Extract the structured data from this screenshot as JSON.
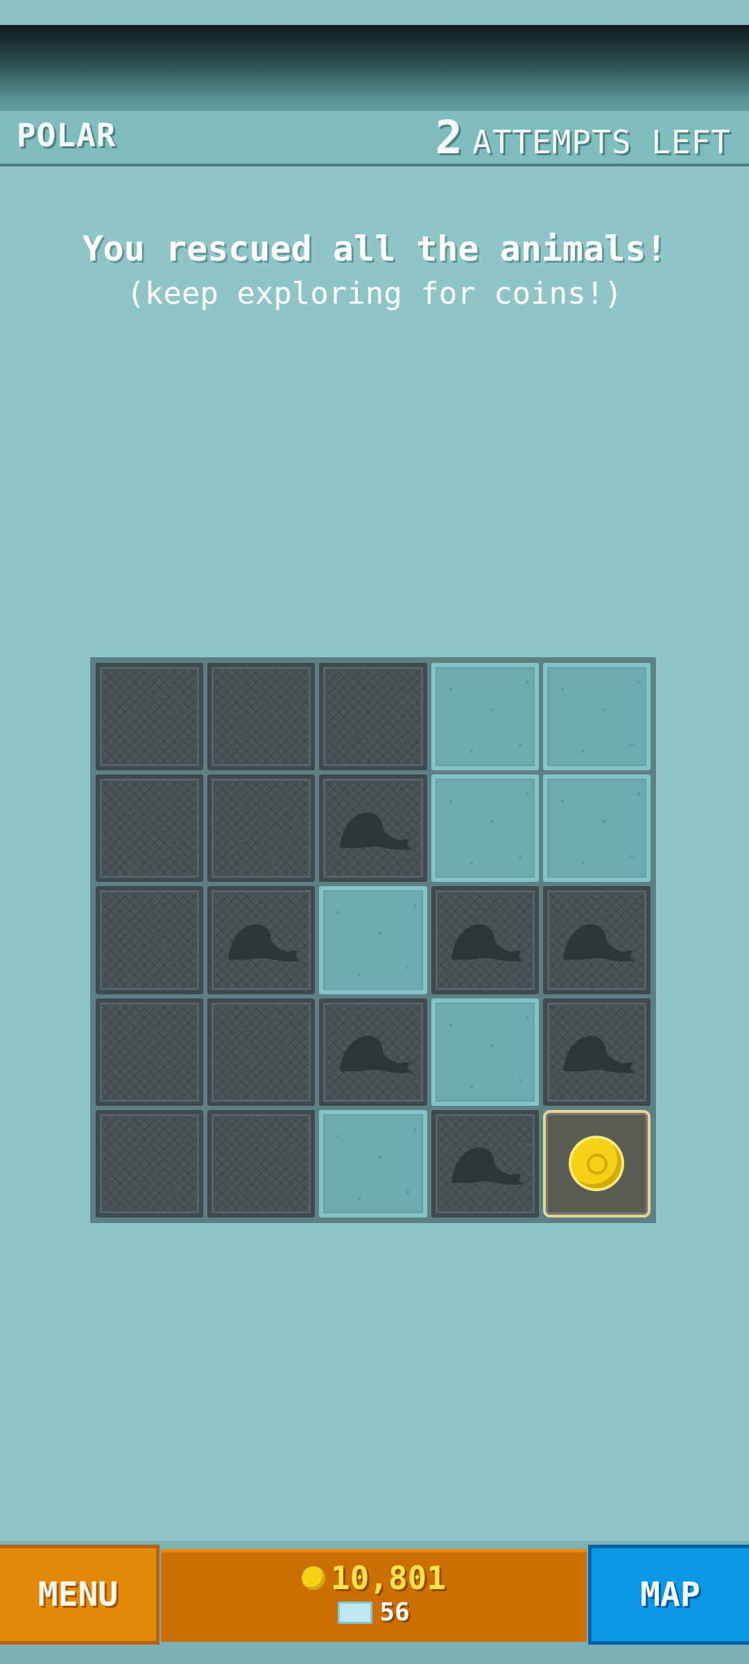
{
  "header": {
    "level_name": "POLAR",
    "attempts_count": "2",
    "attempts_label": "ATTEMPTS LEFT"
  },
  "message": {
    "title": "You rescued all the animals!",
    "subtitle": "(keep exploring for coins!)"
  },
  "board": {
    "rows": [
      [
        "dark",
        "dark",
        "dark",
        "light",
        "light"
      ],
      [
        "dark",
        "dark",
        "seal",
        "light",
        "light"
      ],
      [
        "dark",
        "seal",
        "light",
        "seal",
        "seal"
      ],
      [
        "dark",
        "dark",
        "seal",
        "light",
        "seal"
      ],
      [
        "dark",
        "dark",
        "light",
        "seal",
        "coin"
      ]
    ]
  },
  "footer": {
    "menu_label": "MENU",
    "coins": "10,801",
    "gems": "56",
    "map_label": "MAP"
  },
  "icons": {
    "seal": "seal-silhouette-icon",
    "coin": "gold-coin-icon",
    "gem": "ticket-icon"
  },
  "colors": {
    "background": "#8fc5c9",
    "menu_button": "#e28a0a",
    "map_button": "#0a98e4",
    "coin": "#f3d117"
  }
}
